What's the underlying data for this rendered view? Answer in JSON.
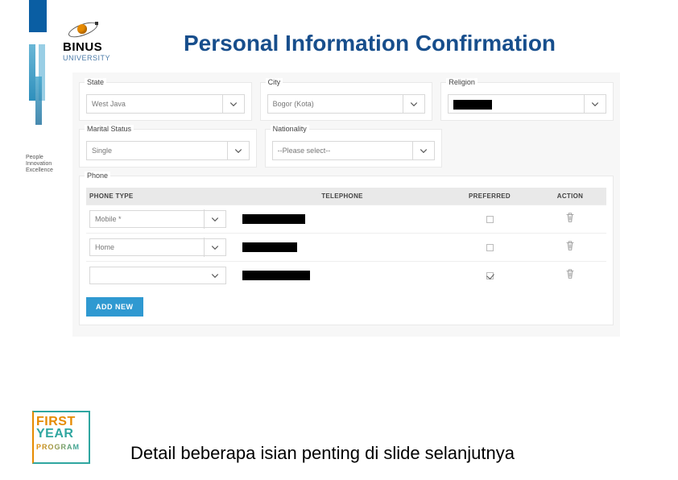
{
  "logo": {
    "name": "BINUS",
    "subtitle": "UNIVERSITY"
  },
  "sidecaption": {
    "l1": "People",
    "l2": "Innovation",
    "l3": "Excellence"
  },
  "title": "Personal Information Confirmation",
  "fields": {
    "state": {
      "label": "State",
      "value": "West Java"
    },
    "city": {
      "label": "City",
      "value": "Bogor (Kota)"
    },
    "religion": {
      "label": "Religion",
      "value": ""
    },
    "marital": {
      "label": "Marital Status",
      "value": "Single"
    },
    "nationality": {
      "label": "Nationality",
      "value": "--Please select--"
    },
    "phone": {
      "label": "Phone"
    }
  },
  "phone_table": {
    "headers": {
      "type": "PHONE TYPE",
      "tel": "TELEPHONE",
      "pref": "PREFERRED",
      "action": "ACTION"
    },
    "rows": [
      {
        "type": "Mobile *",
        "tel_redacted": true,
        "preferred": false
      },
      {
        "type": "Home",
        "tel_redacted": true,
        "preferred": false
      },
      {
        "type": "",
        "tel_redacted": true,
        "preferred": true
      }
    ],
    "add_label": "ADD NEW"
  },
  "footnote": "Detail beberapa isian penting di slide selanjutnya",
  "fyp": {
    "l1": "FIRST",
    "l2": "YEAR",
    "l3": "PROGRAM"
  }
}
